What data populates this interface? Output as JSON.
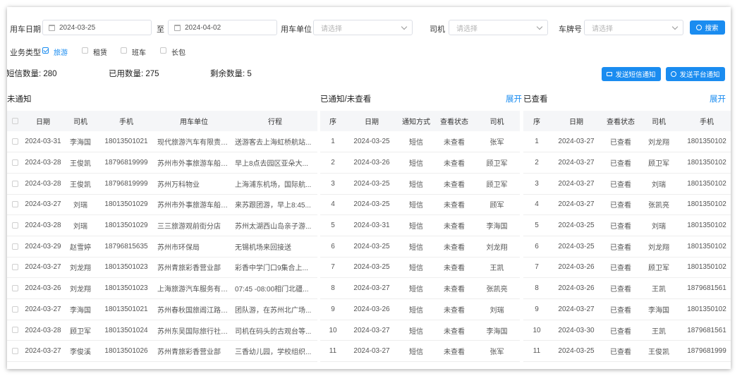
{
  "filters": {
    "date_label": "用车日期",
    "date_from": "2024-03-25",
    "date_sep": "至",
    "date_to": "2024-04-02",
    "unit_label": "用车单位",
    "unit_placeholder": "请选择",
    "driver_label": "司机",
    "driver_placeholder": "请选择",
    "plate_label": "车牌号",
    "plate_placeholder": "请选择",
    "search_label": "搜索",
    "biz_type_label": "业务类型",
    "biz_types": [
      {
        "label": "旅游",
        "checked": true
      },
      {
        "label": "租赁",
        "checked": false
      },
      {
        "label": "班车",
        "checked": false
      },
      {
        "label": "长包",
        "checked": false
      }
    ]
  },
  "stats": {
    "sms_count": "短信数量: 280",
    "used_count": "已用数量: 275",
    "remaining_count": "剩余数量: 5"
  },
  "actions": {
    "send_sms": "发送短信通知",
    "send_platform": "发送平台通知"
  },
  "not_notified": {
    "title": "未通知",
    "columns": [
      "日期",
      "司机",
      "手机",
      "用车单位",
      "行程"
    ],
    "rows": [
      [
        "2024-03-31",
        "李海国",
        "18013501021",
        "现代旅游汽车有限责任...",
        "送游客去上海虹桥航站..."
      ],
      [
        "2024-03-28",
        "王俊凯",
        "18796819999",
        "苏州市外事旅游车船集...",
        "早上8点去园区亚朵大..."
      ],
      [
        "2024-03-28",
        "王俊凯",
        "18796819999",
        "苏州万科物业",
        "上海浦东机场，国际航..."
      ],
      [
        "2024-03-27",
        "刘瑞",
        "18013501029",
        "苏州市外事旅游车船集...",
        "来苏跟团游，早上8:45..."
      ],
      [
        "2024-03-28",
        "刘瑞",
        "18013501029",
        "三三旅游观前街分店",
        "苏州太湖西山岛亲子游..."
      ],
      [
        "2024-03-29",
        "赵雪婷",
        "18796815635",
        "苏州市环保局",
        "无锡机场来回接送"
      ],
      [
        "2024-03-27",
        "刘龙翔",
        "18013501023",
        "苏州青旅彩香营业部",
        "彩香中学门口9集合上..."
      ],
      [
        "2024-03-26",
        "刘龙翔",
        "18013501023",
        "上海旅游汽车服务有限...",
        "07:45 -08:00相门北疆..."
      ],
      [
        "2024-03-27",
        "李海国",
        "18013501021",
        "苏州春秋国旅阊江路营...",
        "团队游，在苏州北广场..."
      ],
      [
        "2024-03-28",
        "顾卫军",
        "18013501024",
        "苏州东吴国际旅行社有...",
        "司机在码头的古观台等..."
      ],
      [
        "2024-03-27",
        "李俊溪",
        "18013501026",
        "苏州青旅彩香营业部",
        "三香幼儿园，学校组织..."
      ]
    ]
  },
  "notified_unviewed": {
    "title": "已通知/未查看",
    "expand": "展开",
    "columns": [
      "序",
      "日期",
      "通知方式",
      "查看状态",
      "司机"
    ],
    "rows": [
      [
        "1",
        "2024-03-25",
        "短信",
        "未查看",
        "张军"
      ],
      [
        "2",
        "2024-03-26",
        "短信",
        "未查看",
        "顾卫军"
      ],
      [
        "3",
        "2024-03-25",
        "短信",
        "未查看",
        "顾卫军"
      ],
      [
        "4",
        "2024-03-25",
        "短信",
        "未查看",
        "顾军"
      ],
      [
        "5",
        "2024-03-31",
        "短信",
        "未查看",
        "李海国"
      ],
      [
        "6",
        "2024-03-25",
        "短信",
        "未查看",
        "刘龙翔"
      ],
      [
        "7",
        "2024-03-25",
        "短信",
        "未查看",
        "王凯"
      ],
      [
        "8",
        "2024-03-27",
        "短信",
        "未查看",
        "张凯亮"
      ],
      [
        "9",
        "2024-03-26",
        "短信",
        "未查看",
        "刘瑞"
      ],
      [
        "10",
        "2024-03-27",
        "短信",
        "未查看",
        "李海国"
      ],
      [
        "11",
        "2024-03-27",
        "短信",
        "未查看",
        "张军"
      ]
    ]
  },
  "viewed": {
    "title": "已查看",
    "expand": "展开",
    "columns": [
      "序",
      "日期",
      "查看状态",
      "司机",
      "手机"
    ],
    "rows": [
      [
        "1",
        "2024-03-27",
        "已查看",
        "刘龙翔",
        "1801350102"
      ],
      [
        "2",
        "2024-03-27",
        "已查看",
        "顾卫军",
        "1801350102"
      ],
      [
        "3",
        "2024-03-27",
        "已查看",
        "刘瑞",
        "1801350102"
      ],
      [
        "4",
        "2024-03-27",
        "已查看",
        "张凯亮",
        "1801350102"
      ],
      [
        "5",
        "2024-03-25",
        "已查看",
        "刘瑞",
        "1801350102"
      ],
      [
        "6",
        "2024-03-25",
        "已查看",
        "刘龙翔",
        "1801350102"
      ],
      [
        "7",
        "2024-03-26",
        "已查看",
        "顾卫军",
        "1801350102"
      ],
      [
        "8",
        "2024-03-26",
        "已查看",
        "王凯",
        "1879681561"
      ],
      [
        "9",
        "2024-03-27",
        "已查看",
        "李海国",
        "1801350102"
      ],
      [
        "10",
        "2024-03-30",
        "已查看",
        "王凯",
        "1879681561"
      ],
      [
        "11",
        "2024-03-25",
        "已查看",
        "王俊凯",
        "1879681999"
      ]
    ]
  }
}
